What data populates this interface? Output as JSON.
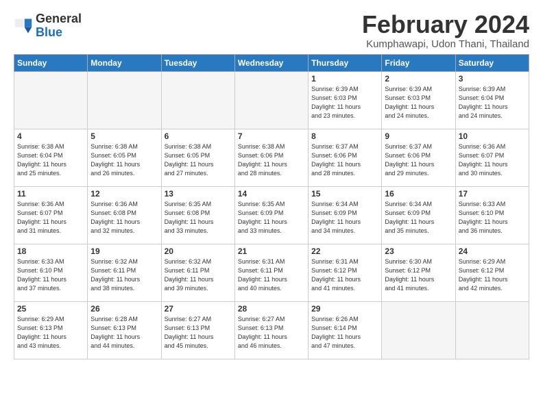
{
  "logo": {
    "general": "General",
    "blue": "Blue"
  },
  "header": {
    "month_year": "February 2024",
    "location": "Kumphawapi, Udon Thani, Thailand"
  },
  "weekdays": [
    "Sunday",
    "Monday",
    "Tuesday",
    "Wednesday",
    "Thursday",
    "Friday",
    "Saturday"
  ],
  "weeks": [
    [
      {
        "day": "",
        "info": ""
      },
      {
        "day": "",
        "info": ""
      },
      {
        "day": "",
        "info": ""
      },
      {
        "day": "",
        "info": ""
      },
      {
        "day": "1",
        "info": "Sunrise: 6:39 AM\nSunset: 6:03 PM\nDaylight: 11 hours\nand 23 minutes."
      },
      {
        "day": "2",
        "info": "Sunrise: 6:39 AM\nSunset: 6:03 PM\nDaylight: 11 hours\nand 24 minutes."
      },
      {
        "day": "3",
        "info": "Sunrise: 6:39 AM\nSunset: 6:04 PM\nDaylight: 11 hours\nand 24 minutes."
      }
    ],
    [
      {
        "day": "4",
        "info": "Sunrise: 6:38 AM\nSunset: 6:04 PM\nDaylight: 11 hours\nand 25 minutes."
      },
      {
        "day": "5",
        "info": "Sunrise: 6:38 AM\nSunset: 6:05 PM\nDaylight: 11 hours\nand 26 minutes."
      },
      {
        "day": "6",
        "info": "Sunrise: 6:38 AM\nSunset: 6:05 PM\nDaylight: 11 hours\nand 27 minutes."
      },
      {
        "day": "7",
        "info": "Sunrise: 6:38 AM\nSunset: 6:06 PM\nDaylight: 11 hours\nand 28 minutes."
      },
      {
        "day": "8",
        "info": "Sunrise: 6:37 AM\nSunset: 6:06 PM\nDaylight: 11 hours\nand 28 minutes."
      },
      {
        "day": "9",
        "info": "Sunrise: 6:37 AM\nSunset: 6:06 PM\nDaylight: 11 hours\nand 29 minutes."
      },
      {
        "day": "10",
        "info": "Sunrise: 6:36 AM\nSunset: 6:07 PM\nDaylight: 11 hours\nand 30 minutes."
      }
    ],
    [
      {
        "day": "11",
        "info": "Sunrise: 6:36 AM\nSunset: 6:07 PM\nDaylight: 11 hours\nand 31 minutes."
      },
      {
        "day": "12",
        "info": "Sunrise: 6:36 AM\nSunset: 6:08 PM\nDaylight: 11 hours\nand 32 minutes."
      },
      {
        "day": "13",
        "info": "Sunrise: 6:35 AM\nSunset: 6:08 PM\nDaylight: 11 hours\nand 33 minutes."
      },
      {
        "day": "14",
        "info": "Sunrise: 6:35 AM\nSunset: 6:09 PM\nDaylight: 11 hours\nand 33 minutes."
      },
      {
        "day": "15",
        "info": "Sunrise: 6:34 AM\nSunset: 6:09 PM\nDaylight: 11 hours\nand 34 minutes."
      },
      {
        "day": "16",
        "info": "Sunrise: 6:34 AM\nSunset: 6:09 PM\nDaylight: 11 hours\nand 35 minutes."
      },
      {
        "day": "17",
        "info": "Sunrise: 6:33 AM\nSunset: 6:10 PM\nDaylight: 11 hours\nand 36 minutes."
      }
    ],
    [
      {
        "day": "18",
        "info": "Sunrise: 6:33 AM\nSunset: 6:10 PM\nDaylight: 11 hours\nand 37 minutes."
      },
      {
        "day": "19",
        "info": "Sunrise: 6:32 AM\nSunset: 6:11 PM\nDaylight: 11 hours\nand 38 minutes."
      },
      {
        "day": "20",
        "info": "Sunrise: 6:32 AM\nSunset: 6:11 PM\nDaylight: 11 hours\nand 39 minutes."
      },
      {
        "day": "21",
        "info": "Sunrise: 6:31 AM\nSunset: 6:11 PM\nDaylight: 11 hours\nand 40 minutes."
      },
      {
        "day": "22",
        "info": "Sunrise: 6:31 AM\nSunset: 6:12 PM\nDaylight: 11 hours\nand 41 minutes."
      },
      {
        "day": "23",
        "info": "Sunrise: 6:30 AM\nSunset: 6:12 PM\nDaylight: 11 hours\nand 41 minutes."
      },
      {
        "day": "24",
        "info": "Sunrise: 6:29 AM\nSunset: 6:12 PM\nDaylight: 11 hours\nand 42 minutes."
      }
    ],
    [
      {
        "day": "25",
        "info": "Sunrise: 6:29 AM\nSunset: 6:13 PM\nDaylight: 11 hours\nand 43 minutes."
      },
      {
        "day": "26",
        "info": "Sunrise: 6:28 AM\nSunset: 6:13 PM\nDaylight: 11 hours\nand 44 minutes."
      },
      {
        "day": "27",
        "info": "Sunrise: 6:27 AM\nSunset: 6:13 PM\nDaylight: 11 hours\nand 45 minutes."
      },
      {
        "day": "28",
        "info": "Sunrise: 6:27 AM\nSunset: 6:13 PM\nDaylight: 11 hours\nand 46 minutes."
      },
      {
        "day": "29",
        "info": "Sunrise: 6:26 AM\nSunset: 6:14 PM\nDaylight: 11 hours\nand 47 minutes."
      },
      {
        "day": "",
        "info": ""
      },
      {
        "day": "",
        "info": ""
      }
    ]
  ]
}
